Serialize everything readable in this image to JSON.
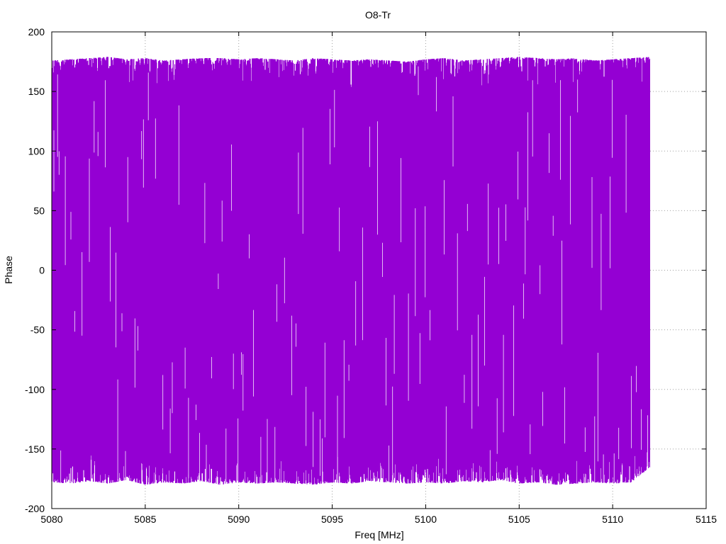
{
  "chart_data": {
    "type": "line",
    "title": "O8-Tr",
    "xlabel": "Freq [MHz]",
    "ylabel": "Phase",
    "xlim": [
      5080,
      5115
    ],
    "ylim": [
      -200,
      200
    ],
    "xticks": [
      5080,
      5085,
      5090,
      5095,
      5100,
      5105,
      5110,
      5115
    ],
    "yticks": [
      -200,
      -150,
      -100,
      -50,
      0,
      50,
      100,
      150,
      200
    ],
    "x_range": [
      5080,
      5112
    ],
    "grid": true,
    "legend": "none",
    "series": [
      {
        "color": "#9400d3",
        "description": "phase wraps rapidly between -180 and 180 across the full band",
        "x_start": 5080,
        "x_end": 5112,
        "y_min": -180,
        "y_max": 180,
        "envelope": [
          [
            5080,
            -178,
            176
          ],
          [
            5081,
            -179,
            177
          ],
          [
            5082,
            -177,
            178
          ],
          [
            5083,
            -179,
            179
          ],
          [
            5084,
            -176,
            177
          ],
          [
            5085,
            -180,
            178
          ],
          [
            5086,
            -178,
            176
          ],
          [
            5087,
            -179,
            177
          ],
          [
            5088,
            -177,
            178
          ],
          [
            5089,
            -180,
            178
          ],
          [
            5090,
            -178,
            177
          ],
          [
            5091,
            -179,
            178
          ],
          [
            5092,
            -178,
            177
          ],
          [
            5093,
            -179,
            176
          ],
          [
            5094,
            -180,
            178
          ],
          [
            5095,
            -178,
            177
          ],
          [
            5096,
            -179,
            176
          ],
          [
            5097,
            -177,
            177
          ],
          [
            5098,
            -178,
            176
          ],
          [
            5099,
            -179,
            175
          ],
          [
            5100,
            -178,
            177
          ],
          [
            5101,
            -179,
            178
          ],
          [
            5102,
            -177,
            176
          ],
          [
            5103,
            -178,
            177
          ],
          [
            5104,
            -176,
            178
          ],
          [
            5105,
            -179,
            179
          ],
          [
            5106,
            -178,
            178
          ],
          [
            5107,
            -180,
            177
          ],
          [
            5108,
            -179,
            178
          ],
          [
            5109,
            -178,
            176
          ],
          [
            5110,
            -179,
            177
          ],
          [
            5111,
            -178,
            178
          ],
          [
            5112,
            -165,
            179
          ]
        ]
      }
    ]
  }
}
